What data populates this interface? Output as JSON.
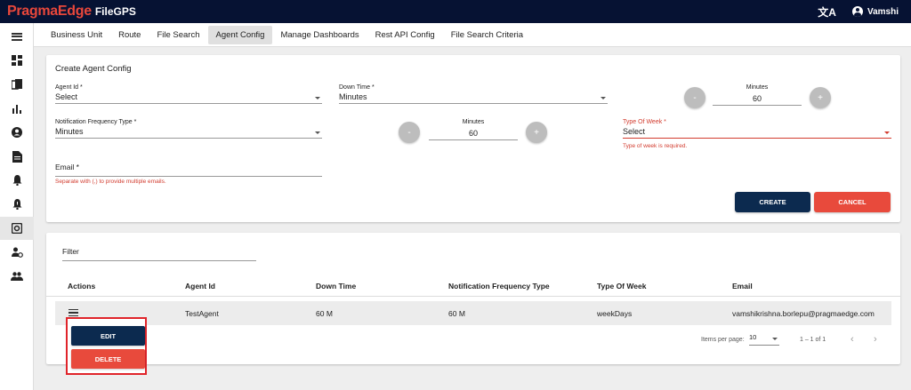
{
  "header": {
    "brand": "PragmaEdge",
    "product": "FileGPS",
    "translate_icon": "translate-icon",
    "user_name": "Vamshi"
  },
  "sidebar": {
    "items": [
      {
        "icon": "menu-icon"
      },
      {
        "icon": "dashboard-icon"
      },
      {
        "icon": "copy-files-icon"
      },
      {
        "icon": "bar-chart-icon"
      },
      {
        "icon": "account-circle-icon"
      },
      {
        "icon": "document-icon"
      },
      {
        "icon": "notification-icon"
      },
      {
        "icon": "alert-bell-icon"
      },
      {
        "icon": "settings-icon"
      },
      {
        "icon": "user-settings-icon"
      },
      {
        "icon": "group-icon"
      }
    ]
  },
  "tabs": [
    {
      "label": "Business Unit"
    },
    {
      "label": "Route"
    },
    {
      "label": "File Search"
    },
    {
      "label": "Agent Config",
      "active": true
    },
    {
      "label": "Manage Dashboards"
    },
    {
      "label": "Rest API Config"
    },
    {
      "label": "File Search Criteria"
    }
  ],
  "form": {
    "title": "Create Agent Config",
    "agent_id": {
      "label": "Agent Id *",
      "value": "Select"
    },
    "down_time": {
      "label": "Down Time *",
      "value": "Minutes"
    },
    "down_minutes": {
      "label": "Minutes",
      "value": "60",
      "minus": "-",
      "plus": "+"
    },
    "notif_type": {
      "label": "Notification Frequency Type *",
      "value": "Minutes"
    },
    "notif_minutes": {
      "label": "Minutes",
      "value": "60",
      "minus": "-",
      "plus": "+"
    },
    "type_of_week": {
      "label": "Type Of Week *",
      "value": "Select",
      "error": "Type of week is required."
    },
    "email": {
      "label": "Email *",
      "value": "",
      "hint": "Separate with (,) to provide multiple emails."
    },
    "create_label": "CREATE",
    "cancel_label": "CANCEL",
    "error_color": "#d23b2e"
  },
  "table": {
    "filter_label": "Filter",
    "columns": [
      "Actions",
      "Agent Id",
      "Down Time",
      "Notification Frequency Type",
      "Type Of Week",
      "Email"
    ],
    "rows": [
      {
        "agent_id": "TestAgent",
        "down_time": "60 M",
        "notif_type": "60 M",
        "type_of_week": "weekDays",
        "email": "vamshikrishna.borlepu@pragmaedge.com"
      }
    ],
    "actions_menu": {
      "edit": "EDIT",
      "delete": "DELETE"
    },
    "paginator": {
      "items_per_page_label": "Items per page:",
      "items_per_page": "10",
      "range": "1 – 1 of 1"
    }
  },
  "colors": {
    "navy": "#061233",
    "button_navy": "#0c2a4f",
    "accent_red": "#e84a3c"
  }
}
